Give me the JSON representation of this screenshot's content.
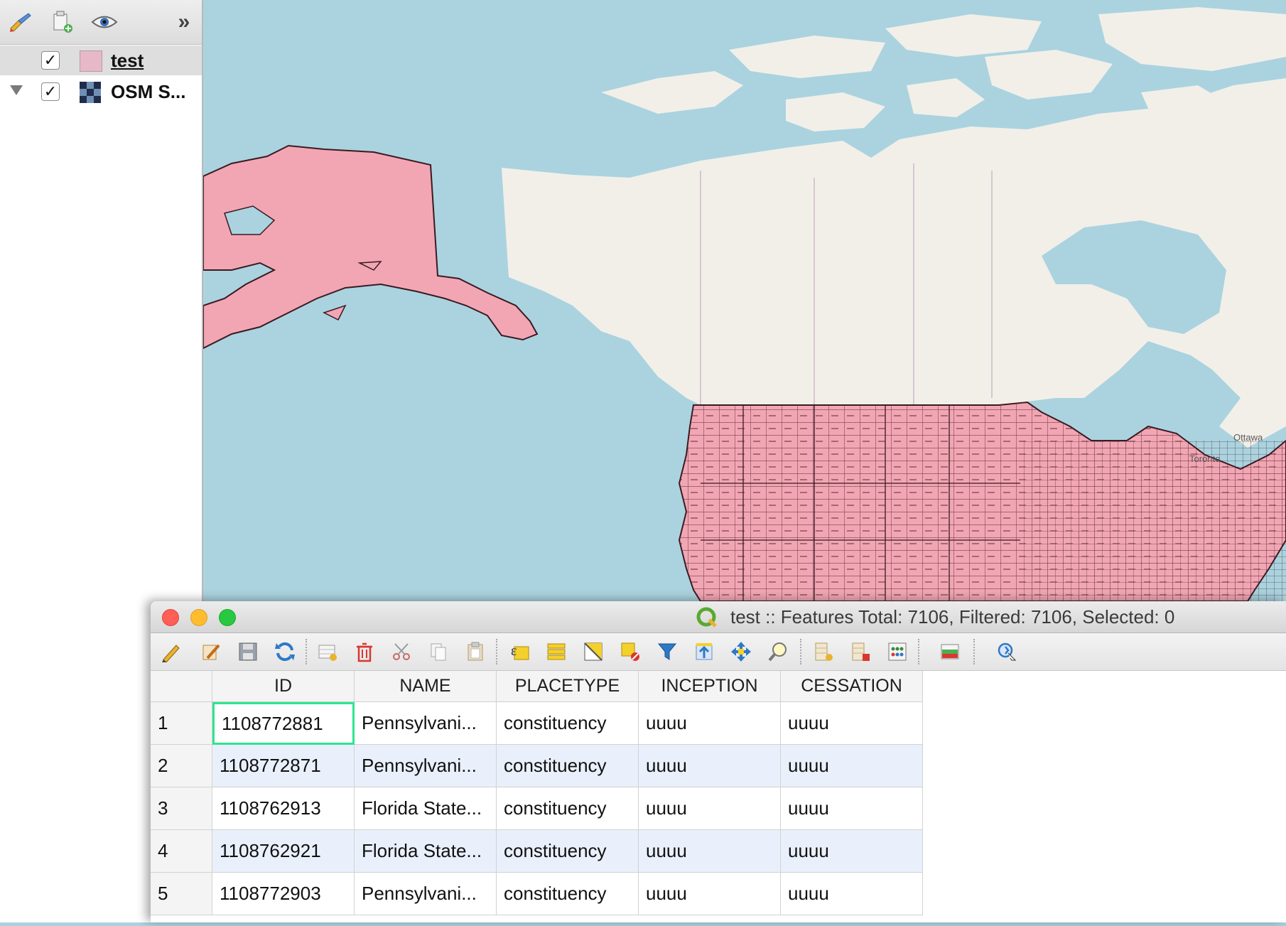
{
  "layers_panel": {
    "toolbar": {
      "style_icon": "paintbrush-icon",
      "add_group_icon": "add-group-icon",
      "visibility_icon": "eye-icon",
      "more_label": "»"
    },
    "layers": [
      {
        "name": "test",
        "checked": "✓",
        "symbol": "pink-polygon-swatch"
      },
      {
        "name": "OSM S...",
        "checked": "✓",
        "symbol": "raster-tiles-icon"
      }
    ]
  },
  "map": {
    "labels": [
      "Ottawa",
      "Toronto"
    ]
  },
  "attribute_window": {
    "title": "test :: Features Total: 7106, Filtered: 7106, Selected: 0",
    "toolbar_icons": [
      "toggle-editing-icon",
      "multi-edit-icon",
      "save-edits-icon",
      "reload-icon",
      "add-feature-icon",
      "delete-feature-icon",
      "cut-icon",
      "copy-icon",
      "paste-icon",
      "select-by-expression-icon",
      "select-all-icon",
      "invert-selection-icon",
      "deselect-all-icon",
      "filter-icon",
      "move-selection-to-top-icon",
      "pan-to-selected-icon",
      "zoom-to-selected-icon",
      "new-field-icon",
      "delete-field-icon",
      "field-calculator-icon",
      "conditional-formatting-icon",
      "actions-icon"
    ],
    "table": {
      "columns": [
        "ID",
        "NAME",
        "PLACETYPE",
        "INCEPTION",
        "CESSATION"
      ],
      "rows": [
        {
          "num": "1",
          "cells": [
            "1108772881",
            "Pennsylvani...",
            "constituency",
            "uuuu",
            "uuuu"
          ]
        },
        {
          "num": "2",
          "cells": [
            "1108772871",
            "Pennsylvani...",
            "constituency",
            "uuuu",
            "uuuu"
          ]
        },
        {
          "num": "3",
          "cells": [
            "1108762913",
            "Florida State...",
            "constituency",
            "uuuu",
            "uuuu"
          ]
        },
        {
          "num": "4",
          "cells": [
            "1108762921",
            "Florida State...",
            "constituency",
            "uuuu",
            "uuuu"
          ]
        },
        {
          "num": "5",
          "cells": [
            "1108772903",
            "Pennsylvani...",
            "constituency",
            "uuuu",
            "uuuu"
          ]
        }
      ]
    }
  },
  "colors": {
    "water": "#aad3df",
    "land": "#f2efe9",
    "polygon_fill": "#f2a6b3",
    "selected_cell_border": "#2ee68f",
    "alt_row": "#e9f0fb"
  }
}
